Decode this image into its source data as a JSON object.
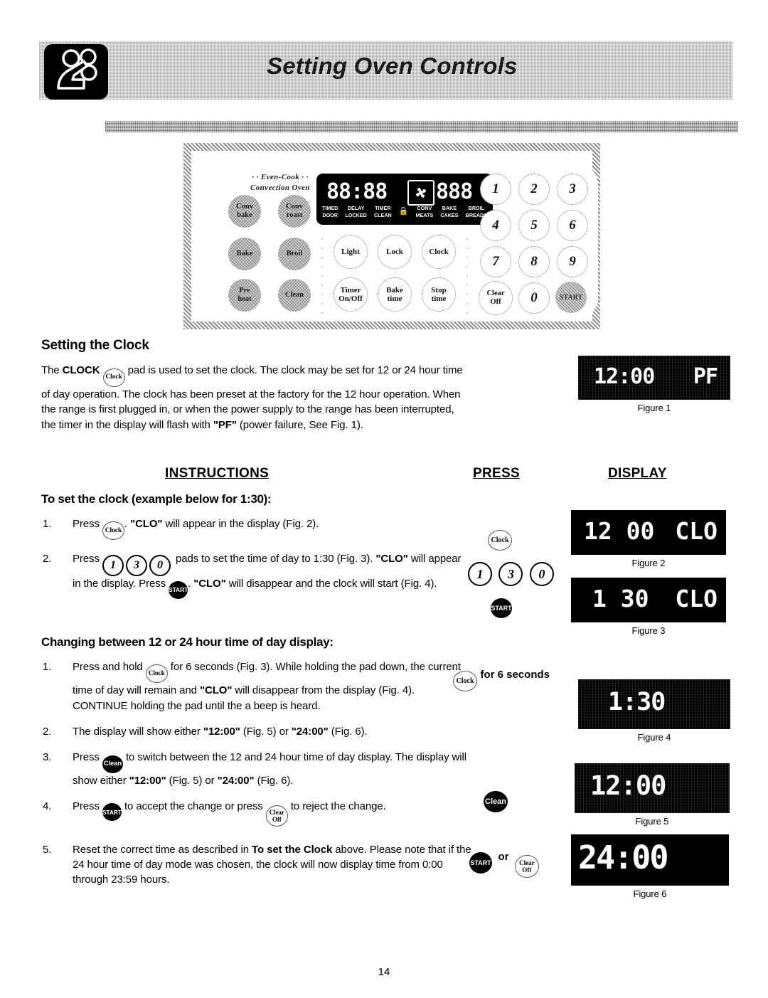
{
  "header": {
    "title": "Setting Oven Controls",
    "icon": "hand-pressing-pad-icon"
  },
  "control_panel": {
    "brand_line1": "· · Even-Cook · ·",
    "brand_line2": "Convection Oven",
    "function_pads": [
      {
        "line1": "Conv",
        "line2": "bake"
      },
      {
        "line1": "Conv",
        "line2": "roast"
      },
      {
        "line1": "Bake",
        "line2": ""
      },
      {
        "line1": "Broil",
        "line2": ""
      },
      {
        "line1": "Pre",
        "line2": "heat"
      },
      {
        "line1": "Clean",
        "line2": ""
      }
    ],
    "control_pads": [
      {
        "line1": "Light",
        "line2": ""
      },
      {
        "line1": "Lock",
        "line2": ""
      },
      {
        "line1": "Clock",
        "line2": ""
      },
      {
        "line1": "Timer",
        "line2": "On/Off"
      },
      {
        "line1": "Bake",
        "line2": "time"
      },
      {
        "line1": "Stop",
        "line2": "time"
      }
    ],
    "number_pads": [
      "1",
      "2",
      "3",
      "4",
      "5",
      "6",
      "7",
      "8",
      "9",
      "0"
    ],
    "clear_off_pad": {
      "line1": "Clear",
      "line2": "Off"
    },
    "start_pad": "START",
    "display": {
      "time_segments": "88:88",
      "right_segments": "888",
      "fan_icon": "convection-fan-icon",
      "lock_icon": "door-lock-icon",
      "indicators": [
        {
          "top": "TIMED",
          "bottom": "DOOR"
        },
        {
          "top": "DELAY",
          "bottom": "LOCKED"
        },
        {
          "top": "TIMER",
          "bottom": "CLEAN"
        },
        {
          "top": "",
          "bottom": ""
        },
        {
          "top": "CONV",
          "bottom": "MEATS"
        },
        {
          "top": "BAKE",
          "bottom": "CAKES"
        },
        {
          "top": "BROIL",
          "bottom": "BREADS"
        }
      ]
    }
  },
  "setting_clock": {
    "heading": "Setting the Clock",
    "para_lead": "The ",
    "para_clock_bold": "CLOCK",
    "pad_label": "Clock",
    "para_rest": " pad is used to set the clock. The clock may be set for 12 or 24 hour time of day operation.  The clock has been preset at the factory for the 12 hour operation.  When the range is first plugged in, or when the power supply to the range has been interrupted, the timer in the display will flash with ",
    "pf_bold": "\"PF\"",
    "para_tail": " (power failure, See Fig. 1)."
  },
  "column_headers": {
    "instructions": "INSTRUCTIONS",
    "press": "PRESS",
    "display": "DISPLAY"
  },
  "to_set_clock": {
    "heading": "To set the clock (example below for 1:30):",
    "step1": {
      "num": "1.",
      "pre": "Press ",
      "pad": "Clock",
      "post_a": ". ",
      "bold": "\"CLO\"",
      "post_b": " will appear in the display (Fig. 2)."
    },
    "step2": {
      "num": "2.",
      "pre": "Press ",
      "pads": [
        "1",
        "3",
        "0"
      ],
      "mid": " pads to set the time of day to 1:30 (Fig. 3). ",
      "bold1": "\"CLO\"",
      "mid2": " will appear in the display.  Press ",
      "start_pad": "START",
      "mid3": ". ",
      "bold2": "\"CLO\"",
      "tail": " will disappear and the clock will start (Fig. 4)."
    }
  },
  "changing_hours": {
    "heading": "Changing between 12 or 24 hour time of day display:",
    "step1": {
      "num": "1.",
      "pre": "Press and hold ",
      "pad": "Clock",
      "mid": " for 6 seconds (Fig. 3). While holding the pad down, the current time of day will remain and ",
      "bold": "\"CLO\"",
      "tail": " will disappear from the display (Fig. 4). CONTINUE holding the pad until the a beep is heard."
    },
    "step2": {
      "num": "2.",
      "pre": "The display will show either ",
      "bold1": "\"12:00\"",
      "mid": " (Fig. 5) or ",
      "bold2": "\"24:00\"",
      "tail": " (Fig. 6)."
    },
    "step3": {
      "num": "3.",
      "pre": "Press ",
      "pad": "Clean",
      "mid": " to switch between the 12 and 24 hour time of day display. The display will show either ",
      "bold1": "\"12:00\"",
      "mid2": " (Fig. 5) or ",
      "bold2": "\"24:00\"",
      "tail": " (Fig. 6)."
    },
    "step4": {
      "num": "4.",
      "pre": "Press ",
      "start_pad": "START",
      "mid": " to accept the change or press ",
      "clear_pad_line1": "Clear",
      "clear_pad_line2": "Off",
      "tail": " to reject the change."
    },
    "step5": {
      "num": "5.",
      "pre": "Reset the correct time as described in ",
      "bold": "To set the Clock",
      "tail": " above. Please note that if the 24 hour time of day mode was chosen, the clock will now display time from 0:00 through 23:59 hours."
    }
  },
  "press_column": {
    "clock_pad": "Clock",
    "num_pads": [
      "1",
      "3",
      "0"
    ],
    "start_pad": "START",
    "clock_hold_pad": "Clock",
    "clock_hold_label": "for 6 seconds",
    "clean_pad": "Clean",
    "start_pad_2": "START",
    "or_label": "or",
    "clear_pad_line1": "Clear",
    "clear_pad_line2": "Off"
  },
  "figures": [
    {
      "id": "figure-1",
      "caption": "Figure 1",
      "left_text": "12:00",
      "right_text": "PF"
    },
    {
      "id": "figure-2",
      "caption": "Figure 2",
      "left_text": "12 00",
      "right_text": "CLO"
    },
    {
      "id": "figure-3",
      "caption": "Figure 3",
      "left_text": "1 30",
      "right_text": "CLO"
    },
    {
      "id": "figure-4",
      "caption": "Figure 4",
      "left_text": "1:30",
      "right_text": ""
    },
    {
      "id": "figure-5",
      "caption": "Figure 5",
      "left_text": "12:00",
      "right_text": ""
    },
    {
      "id": "figure-6",
      "caption": "Figure 6",
      "left_text": "24:00",
      "right_text": ""
    }
  ],
  "page_number": "14"
}
